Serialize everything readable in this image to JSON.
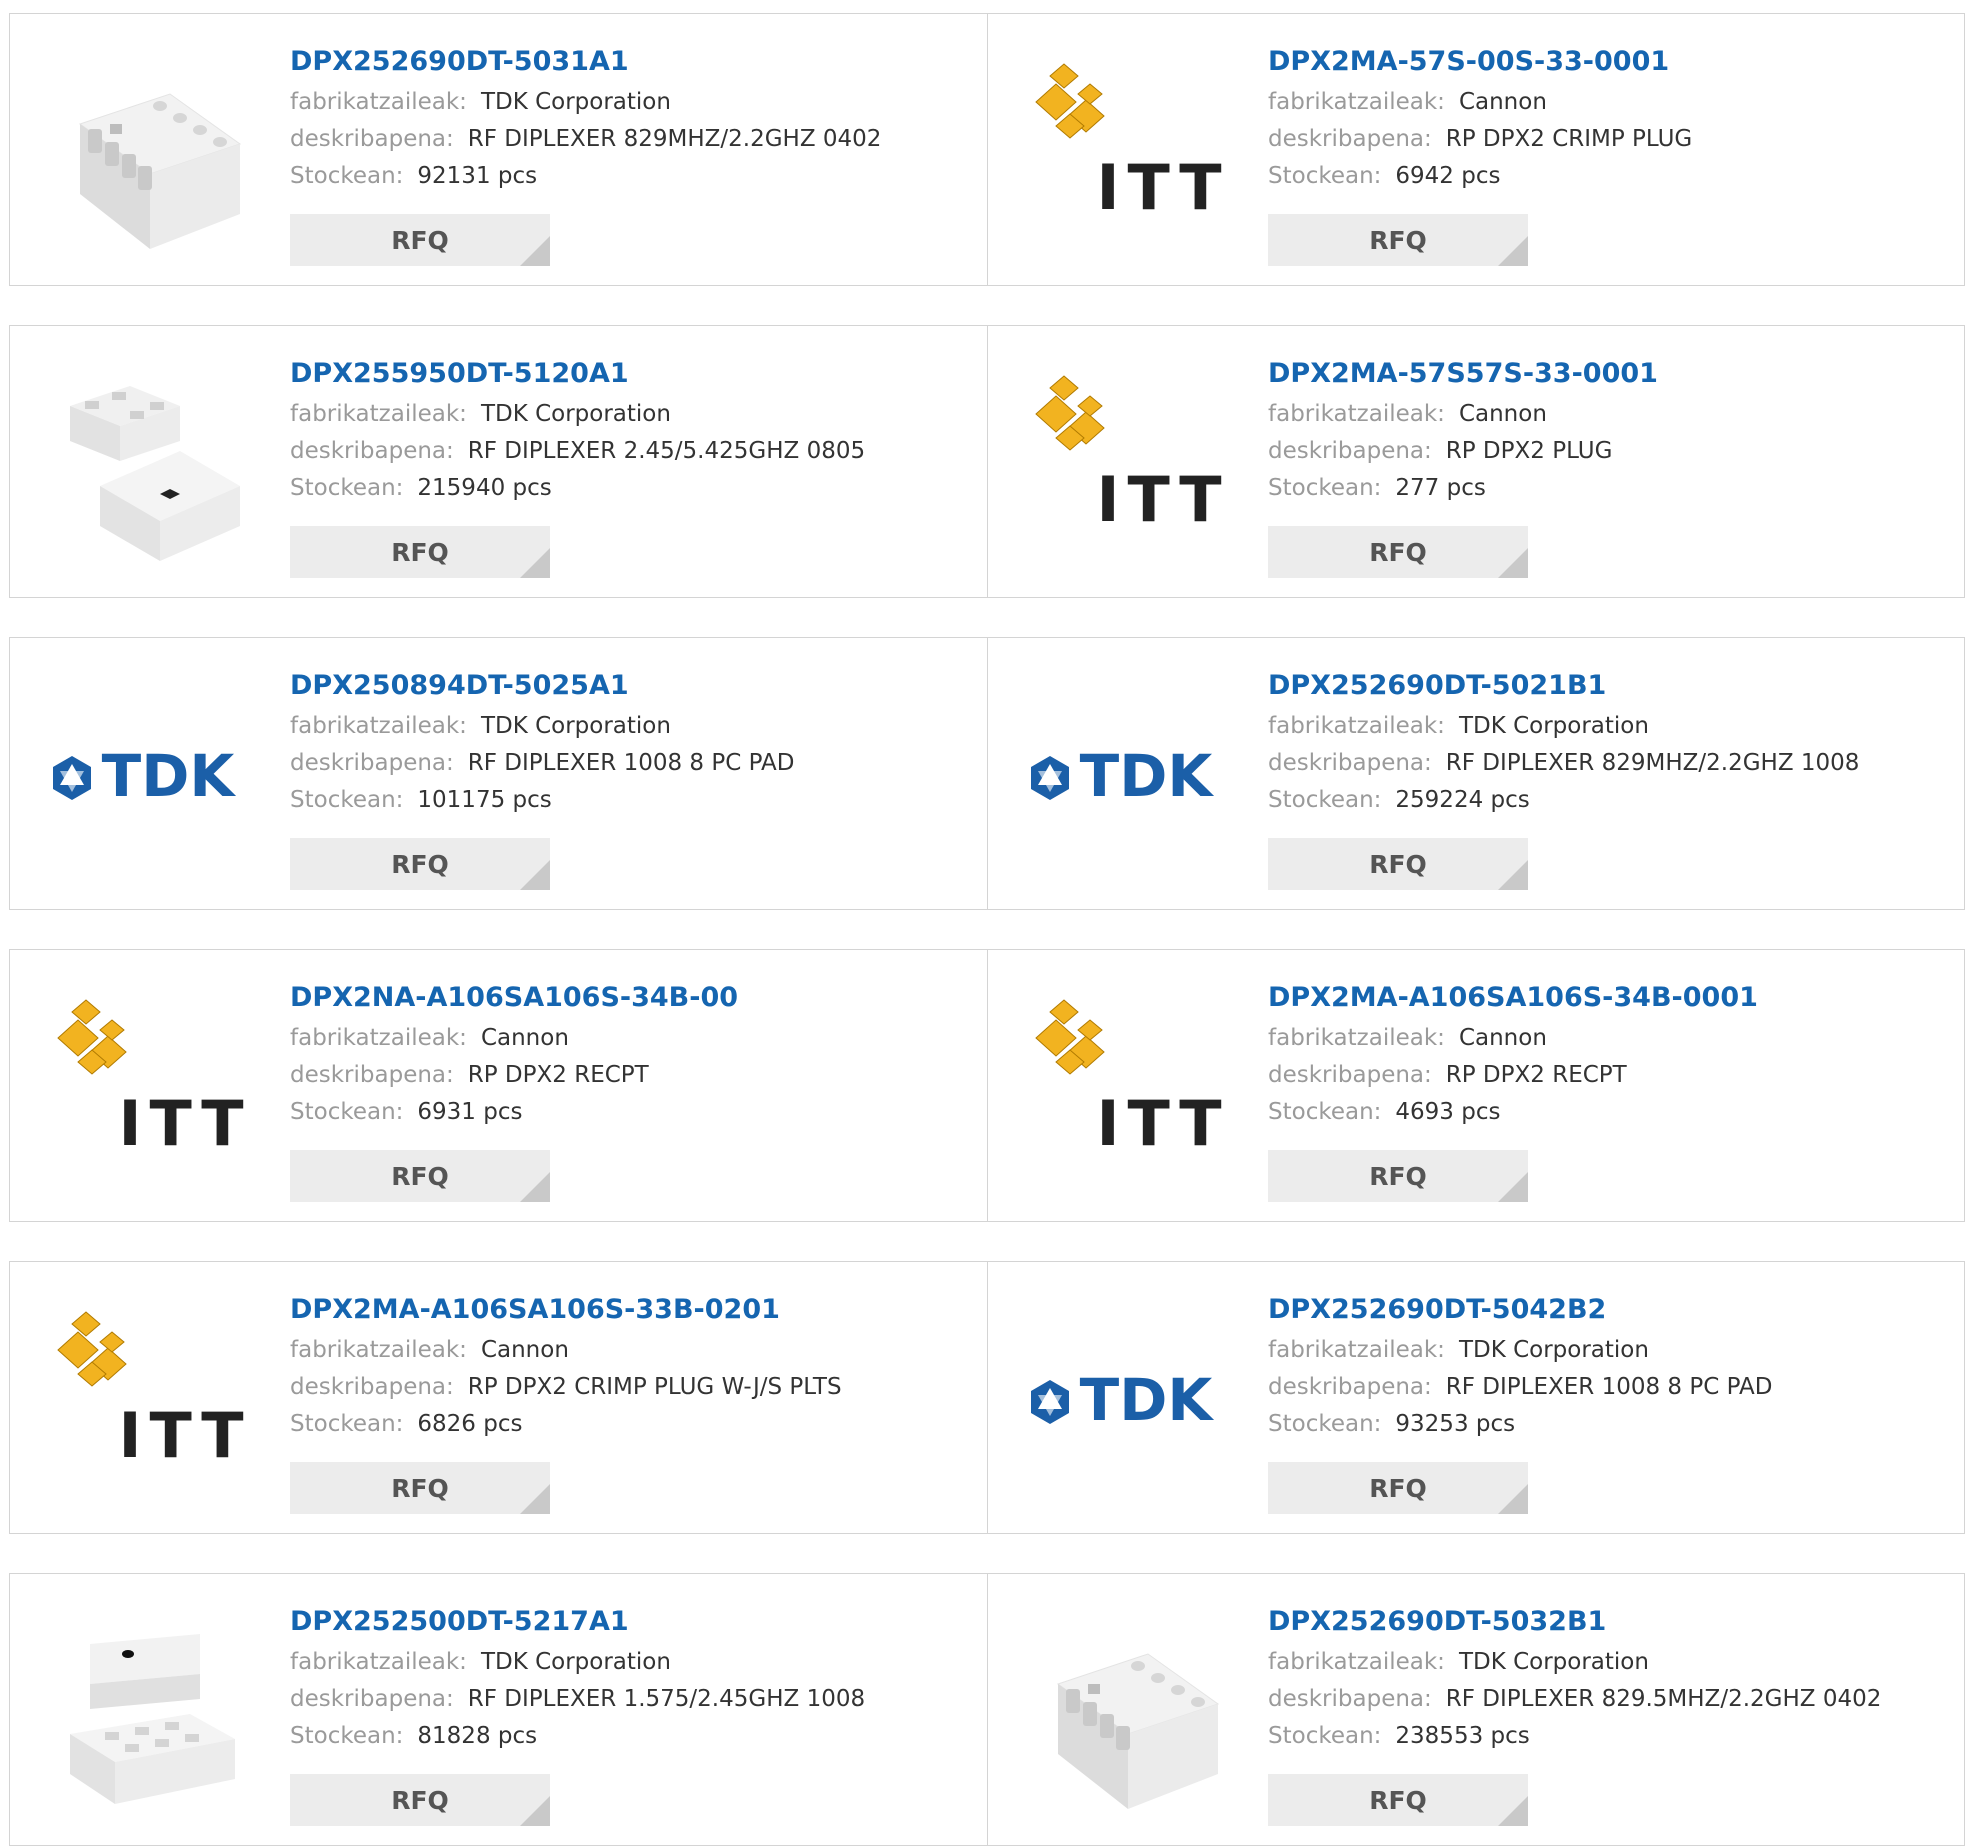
{
  "labels": {
    "manufacturer": "fabrikatzaileak:",
    "description": "deskribapena:",
    "stock": "Stockean:",
    "rfq": "RFQ"
  },
  "colors": {
    "link": "#1565b0",
    "label": "#9a9a9a",
    "value": "#333333",
    "button_bg": "#ececec",
    "itt_yellow": "#f2b320",
    "tdk_blue": "#1b5fa8"
  },
  "products": [
    {
      "part": "DPX252690DT-5031A1",
      "manufacturer": "TDK Corporation",
      "description": "RF DIPLEXER 829MHZ/2.2GHZ 0402",
      "stock": "92131 pcs",
      "image": "chip-8pad-icon"
    },
    {
      "part": "DPX2MA-57S-00S-33-0001",
      "manufacturer": "Cannon",
      "description": "RP DPX2 CRIMP PLUG",
      "stock": "6942 pcs",
      "image": "itt-logo",
      "logo_text": "ITT"
    },
    {
      "part": "DPX255950DT-5120A1",
      "manufacturer": "TDK Corporation",
      "description": "RF DIPLEXER 2.45/5.425GHZ 0805",
      "stock": "215940 pcs",
      "image": "chip-two-view-icon"
    },
    {
      "part": "DPX2MA-57S57S-33-0001",
      "manufacturer": "Cannon",
      "description": "RP DPX2 PLUG",
      "stock": "277 pcs",
      "image": "itt-logo",
      "logo_text": "ITT"
    },
    {
      "part": "DPX250894DT-5025A1",
      "manufacturer": "TDK Corporation",
      "description": "RF DIPLEXER 1008 8 PC PAD",
      "stock": "101175 pcs",
      "image": "tdk-logo",
      "logo_text": "TDK"
    },
    {
      "part": "DPX252690DT-5021B1",
      "manufacturer": "TDK Corporation",
      "description": "RF DIPLEXER 829MHZ/2.2GHZ 1008",
      "stock": "259224 pcs",
      "image": "tdk-logo",
      "logo_text": "TDK"
    },
    {
      "part": "DPX2NA-A106SA106S-34B-00",
      "manufacturer": "Cannon",
      "description": "RP DPX2 RECPT",
      "stock": "6931 pcs",
      "image": "itt-logo",
      "logo_text": "ITT"
    },
    {
      "part": "DPX2MA-A106SA106S-34B-0001",
      "manufacturer": "Cannon",
      "description": "RP DPX2 RECPT",
      "stock": "4693 pcs",
      "image": "itt-logo",
      "logo_text": "ITT"
    },
    {
      "part": "DPX2MA-A106SA106S-33B-0201",
      "manufacturer": "Cannon",
      "description": "RP DPX2 CRIMP PLUG W-J/S PLTS",
      "stock": "6826 pcs",
      "image": "itt-logo",
      "logo_text": "ITT"
    },
    {
      "part": "DPX252690DT-5042B2",
      "manufacturer": "TDK Corporation",
      "description": "RF DIPLEXER 1008 8 PC PAD",
      "stock": "93253 pcs",
      "image": "tdk-logo",
      "logo_text": "TDK"
    },
    {
      "part": "DPX252500DT-5217A1",
      "manufacturer": "TDK Corporation",
      "description": "RF DIPLEXER 1.575/2.45GHZ 1008",
      "stock": "81828 pcs",
      "image": "chip-stack-icon"
    },
    {
      "part": "DPX252690DT-5032B1",
      "manufacturer": "TDK Corporation",
      "description": "RF DIPLEXER 829.5MHZ/2.2GHZ 0402",
      "stock": "238553 pcs",
      "image": "chip-8pad-icon"
    }
  ]
}
